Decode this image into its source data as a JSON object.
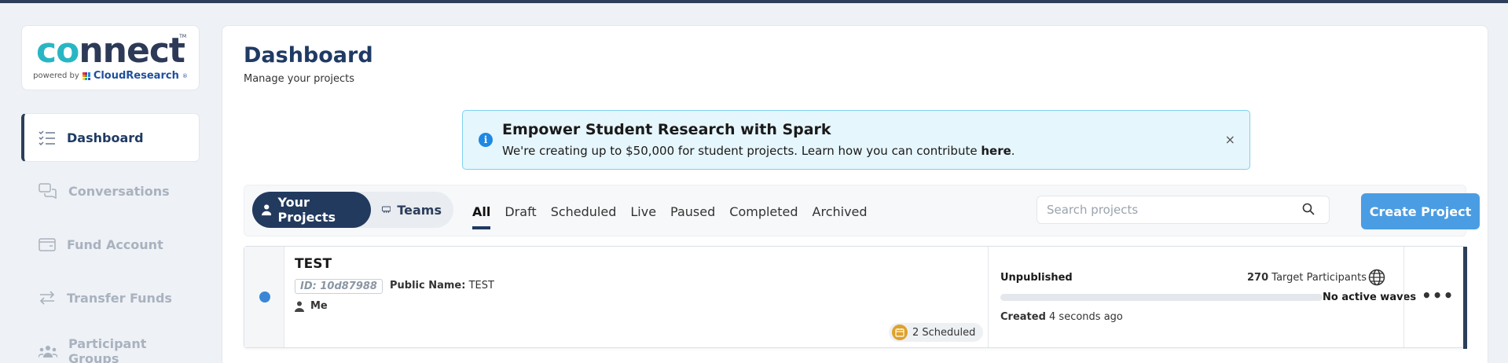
{
  "logo": {
    "wordmark_part1": "co",
    "wordmark_part2": "nnect",
    "tm": "TM",
    "powered_by": "powered by",
    "brand": "CloudResearch",
    "brand_mark": "®"
  },
  "sidebar": {
    "items": [
      {
        "label": "Dashboard",
        "icon": "checklist-icon",
        "active": true
      },
      {
        "label": "Conversations",
        "icon": "chat-icon",
        "active": false
      },
      {
        "label": "Fund Account",
        "icon": "wallet-icon",
        "active": false
      },
      {
        "label": "Transfer Funds",
        "icon": "transfer-icon",
        "active": false
      },
      {
        "label": "Participant Groups",
        "icon": "group-icon",
        "active": false
      }
    ]
  },
  "header": {
    "title": "Dashboard",
    "subtitle": "Manage your projects"
  },
  "banner": {
    "title": "Empower Student Research with Spark",
    "text": "We're creating up to $50,000 for student projects. Learn how you can contribute ",
    "link": "here",
    "period": ".",
    "close": "×"
  },
  "toolbar": {
    "segments": [
      "Your Projects",
      "Teams"
    ],
    "tabs": [
      "All",
      "Draft",
      "Scheduled",
      "Live",
      "Paused",
      "Completed",
      "Archived"
    ],
    "active_tab": "All",
    "search_placeholder": "Search projects",
    "create_label": "Create Project"
  },
  "project": {
    "name": "TEST",
    "id": "ID: 10d87988",
    "public_name_label": "Public Name:",
    "public_name": "TEST",
    "owner": "Me",
    "scheduled": "2 Scheduled",
    "status": "Unpublished",
    "target_count": "270",
    "target_label": "Target Participants",
    "waves": "No active waves",
    "progress": 0,
    "created_label": "Created",
    "created_time": "4 seconds ago",
    "more": "•••"
  },
  "colors": {
    "primary": "#223a5e",
    "accent": "#4a9de3",
    "banner_bg": "#e6f6fd",
    "status_dot": "#3a86d6"
  }
}
